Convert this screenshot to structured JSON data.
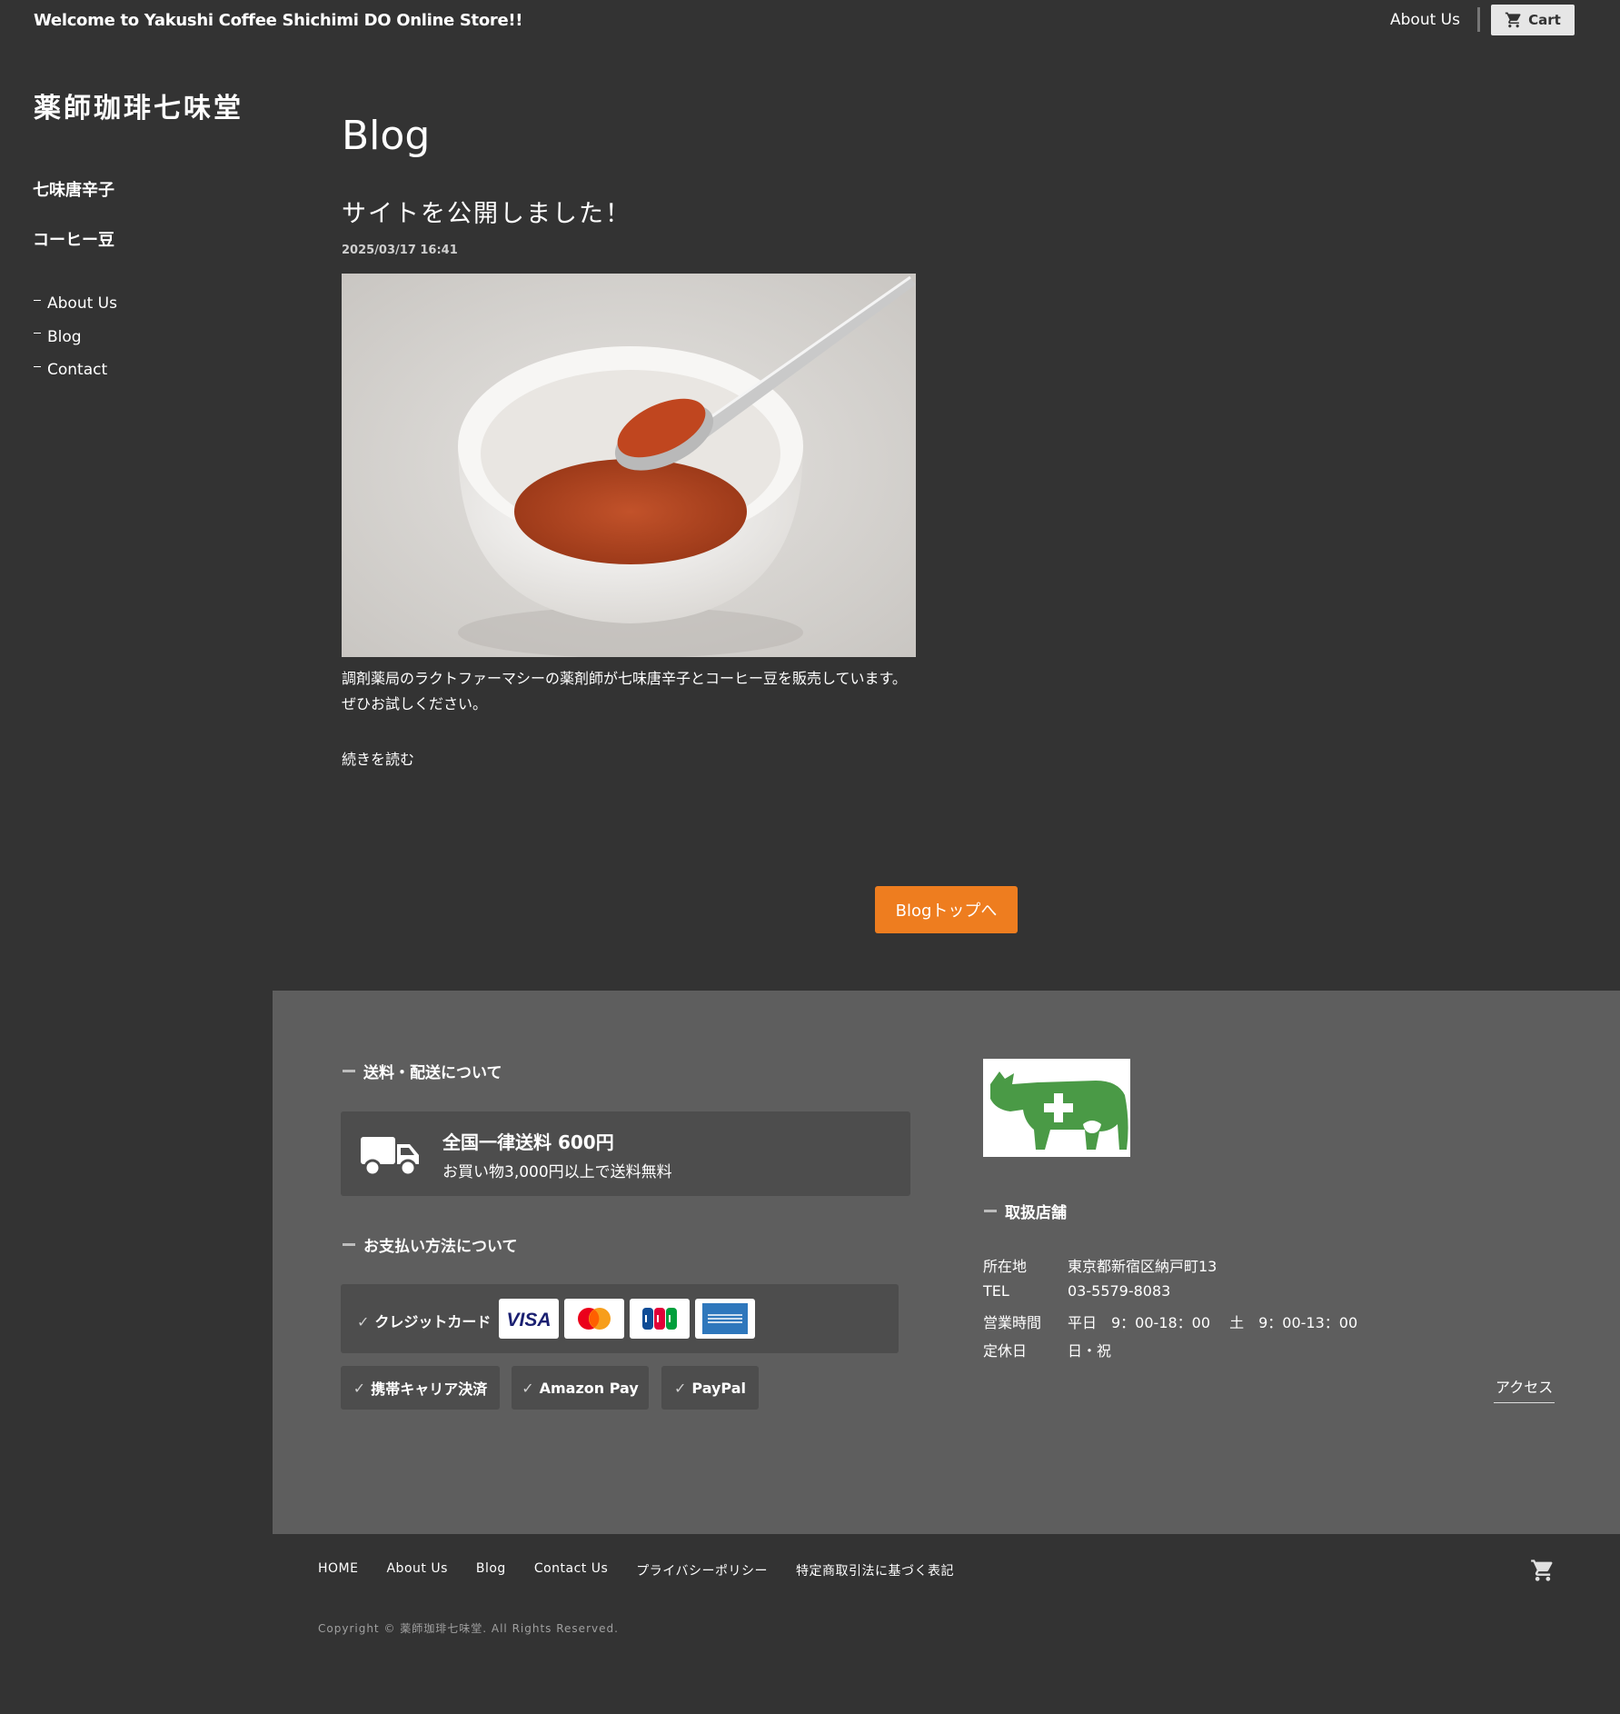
{
  "header": {
    "welcome": "Welcome to Yakushi Coffee Shichimi DO Online Store!!",
    "about_label": "About Us",
    "cart_label": "Cart"
  },
  "sidebar": {
    "logo": "薬師珈琲七味堂",
    "categories": [
      "七味唐辛子",
      "コーヒー豆"
    ],
    "links": [
      "About Us",
      "Blog",
      "Contact"
    ]
  },
  "main": {
    "page_title": "Blog",
    "post": {
      "title": "サイトを公開しました！",
      "date": "2025/03/17 16:41",
      "body": "調剤薬局のラクトファーマシーの薬剤師が七味唐辛子とコーヒー豆を販売しています。ぜひお試しください。",
      "read_more": "続きを読む"
    },
    "blog_top_button": "Blogトップへ"
  },
  "info": {
    "shipping_heading": "送料・配送について",
    "shipping_main": "全国一律送料 600円",
    "shipping_sub": "お買い物3,000円以上で送料無料",
    "payment_heading": "お支払い方法について",
    "credit_label": "クレジットカード",
    "cards": [
      "VISA",
      "Mastercard",
      "JCB",
      "American Express"
    ],
    "payment_options": [
      "携帯キャリア決済",
      "Amazon Pay",
      "PayPal"
    ],
    "shop_heading": "取扱店舗",
    "shop": [
      {
        "label": "所在地",
        "value": "東京都新宿区納戸町13"
      },
      {
        "label": "TEL",
        "value": "03-5579-8083"
      },
      {
        "label": "営業時間",
        "value": "平日　9：00-18：00　 土　9：00-13：00"
      },
      {
        "label": "定休日",
        "value": "日・祝"
      }
    ],
    "access_label": "アクセス"
  },
  "footer": {
    "nav": [
      "HOME",
      "About Us",
      "Blog",
      "Contact Us",
      "プライバシーポリシー",
      "特定商取引法に基づく表記"
    ],
    "copyright": "Copyright © 薬師珈琲七味堂. All Rights Reserved."
  },
  "colors": {
    "background": "#333333",
    "info_background": "#5e5e5e",
    "accent_orange": "#ee7d1f",
    "logo_green": "#4a9a46"
  },
  "icons": [
    "cart-icon",
    "truck-icon",
    "pharmacy-cow-logo"
  ]
}
